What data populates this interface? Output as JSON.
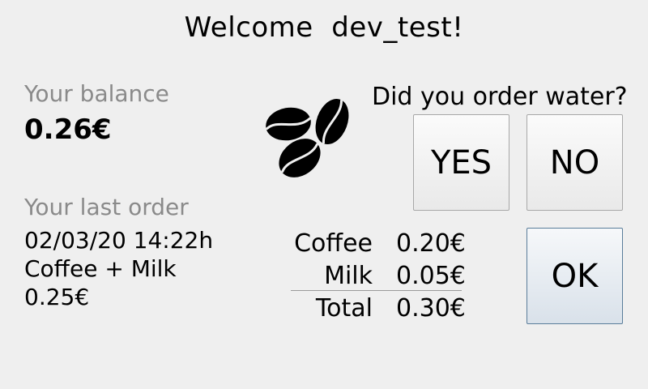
{
  "header": {
    "welcome": "Welcome  dev_test!"
  },
  "balance": {
    "label": "Your balance",
    "value": "0.26€"
  },
  "last_order": {
    "label": "Your last order",
    "datetime": "02/03/20 14:22h",
    "items": "Coffee + Milk",
    "price": "0.25€"
  },
  "water_prompt": {
    "question": "Did you order water?",
    "yes_label": "YES",
    "no_label": "NO"
  },
  "summary": {
    "rows": [
      {
        "label": "Coffee",
        "value": "0.20€"
      },
      {
        "label": "Milk",
        "value": "0.05€"
      }
    ],
    "total_label": "Total",
    "total_value": "0.30€"
  },
  "actions": {
    "ok_label": "OK"
  },
  "icons": {
    "logo": "coffee-beans-icon"
  }
}
